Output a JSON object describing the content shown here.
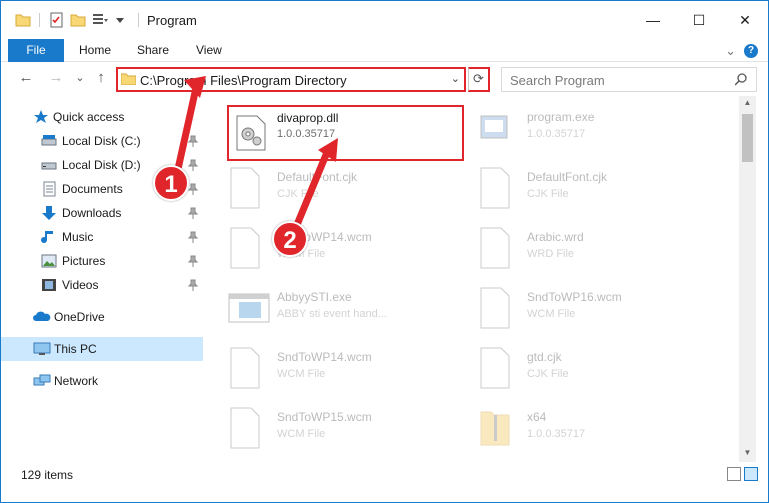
{
  "window": {
    "title": "Program",
    "controls": {
      "minimize": "—",
      "maximize": "☐",
      "close": "✕"
    }
  },
  "ribbon": {
    "tabs": [
      "File",
      "Home",
      "Share",
      "View"
    ],
    "expand": "⌄",
    "help": "?"
  },
  "navigation": {
    "back": "←",
    "forward": "→",
    "recent": "⌄",
    "up": "↑",
    "address": "C:\\Program Files\\Program Directory",
    "address_drop": "⌄",
    "refresh": "⟳",
    "search_placeholder": "Search Program"
  },
  "sidebar": {
    "items": [
      {
        "label": "Quick access",
        "icon": "star-icon"
      },
      {
        "label": "Local Disk (C:)",
        "icon": "disk-icon",
        "pinned": true
      },
      {
        "label": "Local Disk (D:)",
        "icon": "disk-icon",
        "pinned": true
      },
      {
        "label": "Documents",
        "icon": "documents-icon",
        "pinned": true
      },
      {
        "label": "Downloads",
        "icon": "downloads-icon",
        "pinned": true
      },
      {
        "label": "Music",
        "icon": "music-icon",
        "pinned": true
      },
      {
        "label": "Pictures",
        "icon": "pictures-icon",
        "pinned": true
      },
      {
        "label": "Videos",
        "icon": "videos-icon",
        "pinned": true
      },
      {
        "label": "OneDrive",
        "icon": "onedrive-icon"
      },
      {
        "label": "This PC",
        "icon": "pc-icon",
        "selected": true
      },
      {
        "label": "Network",
        "icon": "network-icon"
      }
    ]
  },
  "files": [
    {
      "name": "divaprop.dll",
      "sub": "1.0.0.35717",
      "icon": "dll-gear-icon",
      "highlighted": true
    },
    {
      "name": "program.exe",
      "sub": "1.0.0.35717",
      "icon": "exe-icon",
      "faded": true
    },
    {
      "name": "DefaultFont.cjk",
      "sub": "CJK File",
      "icon": "blank-file-icon",
      "faded": true
    },
    {
      "name": "DefaultFont.cjk",
      "sub": "CJK File",
      "icon": "blank-file-icon",
      "faded": true
    },
    {
      "name": "SndToWP14.wcm",
      "sub": "WCM File",
      "icon": "blank-file-icon",
      "faded": true
    },
    {
      "name": "Arabic.wrd",
      "sub": "WRD File",
      "icon": "blank-file-icon",
      "faded": true
    },
    {
      "name": "AbbyySTI.exe",
      "sub": "ABBY sti event hand...",
      "icon": "app-window-icon",
      "faded": true
    },
    {
      "name": "SndToWP16.wcm",
      "sub": "WCM File",
      "icon": "blank-file-icon",
      "faded": true
    },
    {
      "name": "SndToWP14.wcm",
      "sub": "WCM File",
      "icon": "blank-file-icon",
      "faded": true
    },
    {
      "name": "gtd.cjk",
      "sub": "CJK File",
      "icon": "blank-file-icon",
      "faded": true
    },
    {
      "name": "SndToWP15.wcm",
      "sub": "WCM File",
      "icon": "blank-file-icon",
      "faded": true
    },
    {
      "name": "x64",
      "sub": "1.0.0.35717",
      "icon": "zip-folder-icon",
      "faded": true
    }
  ],
  "status": {
    "item_count": "129 items"
  },
  "annotations": {
    "step1": "1",
    "step2": "2",
    "color": "#e0262b"
  }
}
